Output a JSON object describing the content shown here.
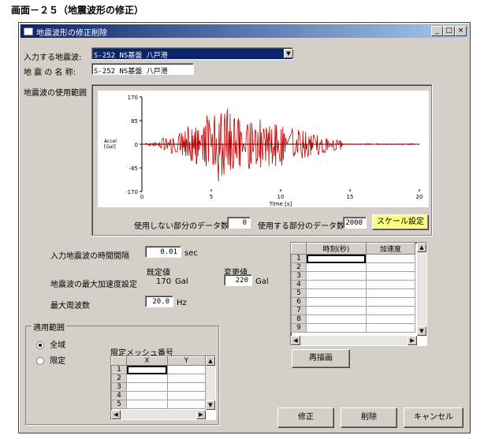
{
  "page_caption": "画面－２５（地震波形の修正）",
  "window": {
    "title": "地震波形の修正削除",
    "controls": {
      "minimize": "_",
      "maximize": "□",
      "close": "×"
    }
  },
  "form": {
    "input_wave_label": "入力する地震波:",
    "input_wave_value": "S-252 NS基盤 八戸港",
    "wave_name_label": "地 震 の 名 称:",
    "wave_name_value": "S-252 NS基盤 八戸港",
    "usage_range_label": "地震波の使用範囲"
  },
  "chart_data": {
    "type": "line",
    "ylabel": "Accel [Gal]",
    "xlabel": "Time [s]",
    "xlim": [
      0,
      20
    ],
    "ylim": [
      -170,
      170
    ],
    "xticks": [
      0,
      5,
      10,
      15,
      20
    ],
    "yticks": [
      170,
      85,
      0,
      -85,
      -170
    ],
    "grid": false,
    "series_color": "#c00000"
  },
  "chart_controls": {
    "unused_label": "使用しない部分のデータ数",
    "unused_value": "0",
    "used_label": "使用する部分のデータ数",
    "used_value": "2000",
    "scale_button": "スケール設定",
    "scale_button_color": "#ffff80"
  },
  "params": {
    "interval_label": "入力地震波の時間間隔",
    "interval_value": "0.01",
    "interval_unit": "sec",
    "default_header": "既定値",
    "changed_header": "変更値",
    "max_accel_label": "地震波の最大加速度設定",
    "max_accel_default": "170",
    "max_accel_default_unit": "Gal",
    "max_accel_value": "220",
    "max_accel_unit": "Gal",
    "max_freq_label": "最大周波数",
    "max_freq_value": "20.0",
    "max_freq_unit": "Hz"
  },
  "time_grid": {
    "col_time": "時刻(秒)",
    "col_accel": "加速度",
    "rows": [
      "1",
      "2",
      "3",
      "4",
      "5",
      "6",
      "7",
      "8",
      "9"
    ]
  },
  "redraw_button": "再描画",
  "apply_group": {
    "title": "適用範囲",
    "radio_all": "全域",
    "radio_limited": "限定",
    "mesh_label": "限定メッシュ番号",
    "col_x": "X",
    "col_y": "Y",
    "rows": [
      "1",
      "2",
      "3",
      "4",
      "5"
    ]
  },
  "actions": {
    "modify": "修正",
    "delete": "削除",
    "cancel": "キャンセル"
  }
}
